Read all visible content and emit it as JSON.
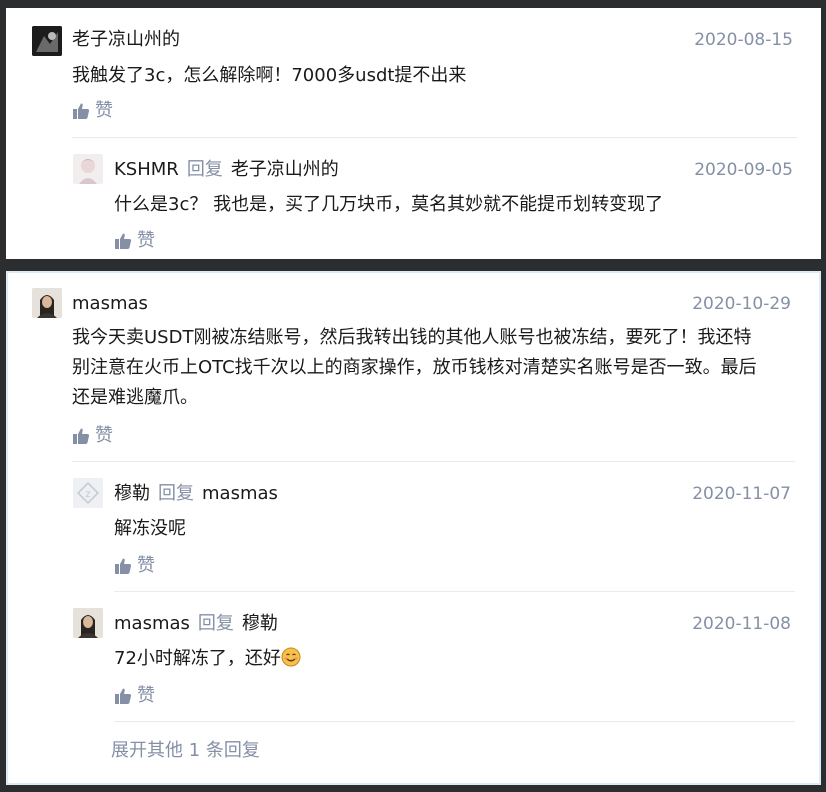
{
  "thread1": {
    "main": {
      "author": "老子凉山州的",
      "date": "2020-08-15",
      "text": "我触发了3c，怎么解除啊！7000多usdt提不出来",
      "like_label": "赞"
    },
    "reply": {
      "author": "KSHMR",
      "reply_word": "回复",
      "reply_to": "老子凉山州的",
      "date": "2020-09-05",
      "text": "什么是3c？ 我也是，买了几万块币，莫名其妙就不能提币划转变现了",
      "like_label": "赞"
    }
  },
  "thread2": {
    "main": {
      "author": "masmas",
      "date": "2020-10-29",
      "text_lines": [
        "我今天卖USDT刚被冻结账号，然后我转出钱的其他人账号也被冻结，要死了！我还特",
        "别注意在火币上OTC找千次以上的商家操作，放币钱核对清楚实名账号是否一致。最后",
        "还是难逃魔爪。"
      ],
      "like_label": "赞"
    },
    "reply1": {
      "author": "穆勒",
      "reply_word": "回复",
      "reply_to": "masmas",
      "date": "2020-11-07",
      "text": "解冻没呢",
      "like_label": "赞"
    },
    "reply2": {
      "author": "masmas",
      "reply_word": "回复",
      "reply_to": "穆勒",
      "date": "2020-11-08",
      "text": "72小时解冻了，还好",
      "emoji": "smiling-face",
      "like_label": "赞"
    },
    "expand_label": "展开其他 1 条回复"
  }
}
